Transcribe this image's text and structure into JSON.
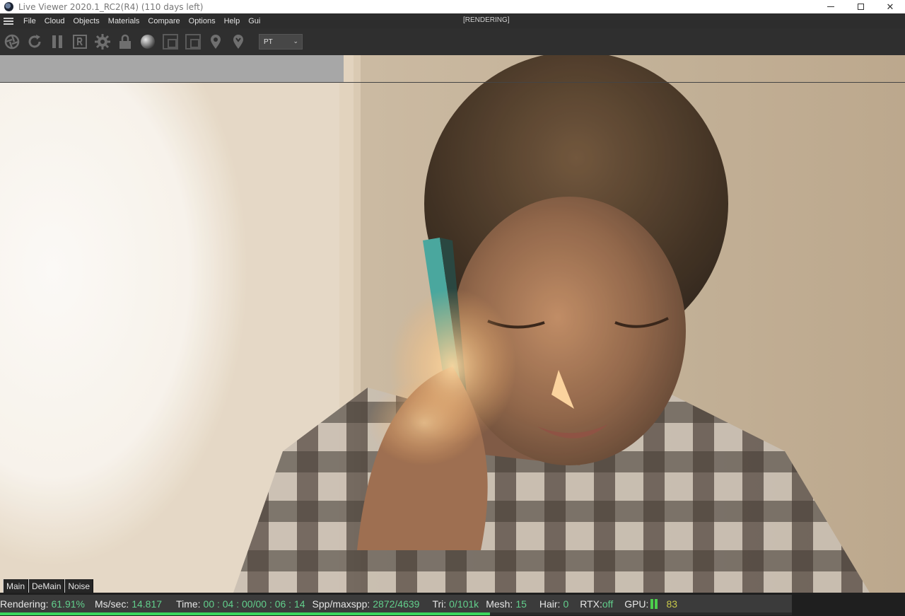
{
  "window": {
    "title": "Live Viewer 2020.1_RC2(R4) (110 days left)",
    "minimize_glyph": "",
    "maximize_glyph": "",
    "close_glyph": "✕"
  },
  "menu": {
    "items": [
      "File",
      "Cloud",
      "Objects",
      "Materials",
      "Compare",
      "Options",
      "Help",
      "Gui"
    ],
    "render_state": "[RENDERING]"
  },
  "toolbar": {
    "icons": [
      "aperture-icon",
      "reload-icon",
      "pause-icon",
      "region-r-icon",
      "settings-gear-icon",
      "lock-icon",
      "material-ball-icon",
      "compare-a-icon",
      "compare-b-icon",
      "pin-focus-icon",
      "pin-picker-icon"
    ],
    "mode_select": {
      "value": "PT"
    }
  },
  "viewport": {
    "image_description_icon": "rendered-image"
  },
  "channels": {
    "tabs": [
      "Main",
      "DeMain",
      "Noise"
    ]
  },
  "status": {
    "rendering_label": "Rendering:",
    "rendering_value": "61.91%",
    "ms_label": "Ms/sec:",
    "ms_value": "14.817",
    "time_label": "Time:",
    "time_value": "00 : 04 : 00/00 : 06 : 14",
    "spp_label": "Spp/maxspp:",
    "spp_value": "2872/4639",
    "tri_label": "Tri:",
    "tri_value": "0/101k",
    "mesh_label": "Mesh:",
    "mesh_value": "15",
    "hair_label": "Hair:",
    "hair_value": "0",
    "rtx_label": "RTX:",
    "rtx_value": "off",
    "gpu_label": "GPU:",
    "gpu_value": "83",
    "progress_fraction": 0.6191
  },
  "colors": {
    "accent_green": "#62cf8c",
    "progress_green": "#3ad65c",
    "gpu_yellow": "#c9c94a"
  }
}
